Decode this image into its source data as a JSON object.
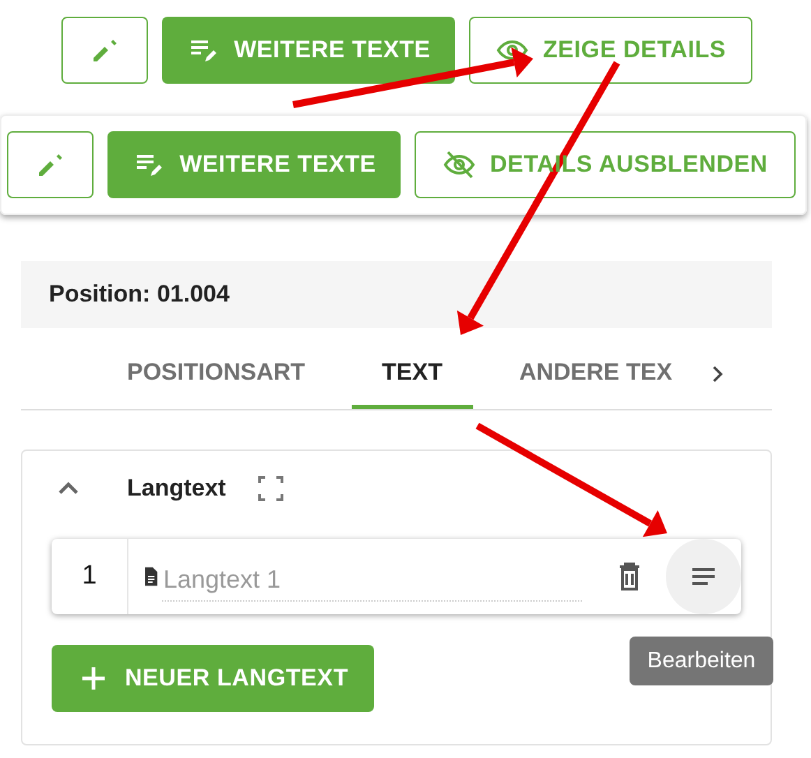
{
  "toolbars": [
    {
      "buttons": [
        {
          "kind": "edit"
        },
        {
          "kind": "texts",
          "label": "WEITERE TEXTE"
        },
        {
          "kind": "show-details",
          "label": "ZEIGE DETAILS"
        }
      ]
    },
    {
      "buttons": [
        {
          "kind": "edit"
        },
        {
          "kind": "texts",
          "label": "WEITERE TEXTE"
        },
        {
          "kind": "hide-details",
          "label": "DETAILS AUSBLENDEN"
        }
      ]
    }
  ],
  "position": "Position: 01.004",
  "tabs": [
    {
      "label": "POSITIONSART",
      "selected": false
    },
    {
      "label": "TEXT",
      "selected": true
    },
    {
      "label": "ANDERE TEX",
      "selected": false
    }
  ],
  "section": {
    "title": "Langtext",
    "expanded": true,
    "rows": [
      {
        "number": "1",
        "placeholder": "Langtext 1"
      }
    ],
    "tooltip": "Bearbeiten",
    "add_button": "NEUER LANGTEXT"
  }
}
